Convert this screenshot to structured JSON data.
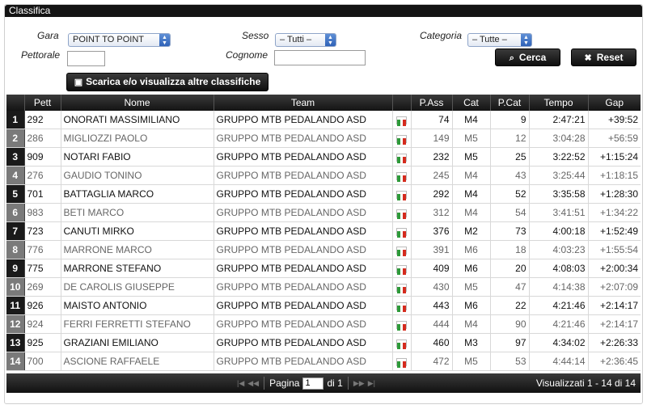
{
  "panel": {
    "title": "Classifica"
  },
  "filters": {
    "gara_label": "Gara",
    "gara_value": "POINT TO POINT",
    "sesso_label": "Sesso",
    "sesso_value": "– Tutti –",
    "categoria_label": "Categoria",
    "categoria_value": "– Tutte –",
    "pettorale_label": "Pettorale",
    "pettorale_value": "",
    "cognome_label": "Cognome",
    "cognome_value": "",
    "search_label": "Cerca",
    "reset_label": "Reset",
    "download_label": "Scarica e/o visualizza altre classifiche"
  },
  "columns": [
    "Pett",
    "Nome",
    "Team",
    "",
    "P.Ass",
    "Cat",
    "P.Cat",
    "Tempo",
    "Gap"
  ],
  "rows": [
    {
      "n": "1",
      "pett": "292",
      "nome": "ONORATI MASSIMILIANO",
      "team": "GRUPPO MTB PEDALANDO ASD",
      "pass": "74",
      "cat": "M4",
      "pcat": "9",
      "tempo": "2:47:21",
      "gap": "+39:52"
    },
    {
      "n": "2",
      "pett": "286",
      "nome": "MIGLIOZZI PAOLO",
      "team": "GRUPPO MTB PEDALANDO ASD",
      "pass": "149",
      "cat": "M5",
      "pcat": "12",
      "tempo": "3:04:28",
      "gap": "+56:59"
    },
    {
      "n": "3",
      "pett": "909",
      "nome": "NOTARI FABIO",
      "team": "GRUPPO MTB PEDALANDO ASD",
      "pass": "232",
      "cat": "M5",
      "pcat": "25",
      "tempo": "3:22:52",
      "gap": "+1:15:24"
    },
    {
      "n": "4",
      "pett": "276",
      "nome": "GAUDIO TONINO",
      "team": "GRUPPO MTB PEDALANDO ASD",
      "pass": "245",
      "cat": "M4",
      "pcat": "43",
      "tempo": "3:25:44",
      "gap": "+1:18:15"
    },
    {
      "n": "5",
      "pett": "701",
      "nome": "BATTAGLIA MARCO",
      "team": "GRUPPO MTB PEDALANDO ASD",
      "pass": "292",
      "cat": "M4",
      "pcat": "52",
      "tempo": "3:35:58",
      "gap": "+1:28:30"
    },
    {
      "n": "6",
      "pett": "983",
      "nome": "BETI MARCO",
      "team": "GRUPPO MTB PEDALANDO ASD",
      "pass": "312",
      "cat": "M4",
      "pcat": "54",
      "tempo": "3:41:51",
      "gap": "+1:34:22"
    },
    {
      "n": "7",
      "pett": "723",
      "nome": "CANUTI MIRKO",
      "team": "GRUPPO MTB PEDALANDO ASD",
      "pass": "376",
      "cat": "M2",
      "pcat": "73",
      "tempo": "4:00:18",
      "gap": "+1:52:49"
    },
    {
      "n": "8",
      "pett": "776",
      "nome": "MARRONE MARCO",
      "team": "GRUPPO MTB PEDALANDO ASD",
      "pass": "391",
      "cat": "M6",
      "pcat": "18",
      "tempo": "4:03:23",
      "gap": "+1:55:54"
    },
    {
      "n": "9",
      "pett": "775",
      "nome": "MARRONE STEFANO",
      "team": "GRUPPO MTB PEDALANDO ASD",
      "pass": "409",
      "cat": "M6",
      "pcat": "20",
      "tempo": "4:08:03",
      "gap": "+2:00:34"
    },
    {
      "n": "10",
      "pett": "269",
      "nome": "DE CAROLIS GIUSEPPE",
      "team": "GRUPPO MTB PEDALANDO ASD",
      "pass": "430",
      "cat": "M5",
      "pcat": "47",
      "tempo": "4:14:38",
      "gap": "+2:07:09"
    },
    {
      "n": "11",
      "pett": "926",
      "nome": "MAISTO ANTONIO",
      "team": "GRUPPO MTB PEDALANDO ASD",
      "pass": "443",
      "cat": "M6",
      "pcat": "22",
      "tempo": "4:21:46",
      "gap": "+2:14:17"
    },
    {
      "n": "12",
      "pett": "924",
      "nome": "FERRI FERRETTI STEFANO",
      "team": "GRUPPO MTB PEDALANDO ASD",
      "pass": "444",
      "cat": "M4",
      "pcat": "90",
      "tempo": "4:21:46",
      "gap": "+2:14:17"
    },
    {
      "n": "13",
      "pett": "925",
      "nome": "GRAZIANI EMILIANO",
      "team": "GRUPPO MTB PEDALANDO ASD",
      "pass": "460",
      "cat": "M3",
      "pcat": "97",
      "tempo": "4:34:02",
      "gap": "+2:26:33"
    },
    {
      "n": "14",
      "pett": "700",
      "nome": "ASCIONE RAFFAELE",
      "team": "GRUPPO MTB PEDALANDO ASD",
      "pass": "472",
      "cat": "M5",
      "pcat": "53",
      "tempo": "4:44:14",
      "gap": "+2:36:45"
    }
  ],
  "pager": {
    "page_label": "Pagina",
    "page_value": "1",
    "of_label": "di 1",
    "summary": "Visualizzati 1 - 14 di 14"
  },
  "colors": {
    "header": "#141414",
    "flag_green": "#2e9a3a",
    "flag_white": "#ffffff",
    "flag_red": "#d52b1e",
    "select_blue": "#2f62b8"
  },
  "icons": {
    "search": "magnifier-icon",
    "reset": "x-icon",
    "download": "floppy-icon",
    "flag": "italy-flag-icon"
  }
}
